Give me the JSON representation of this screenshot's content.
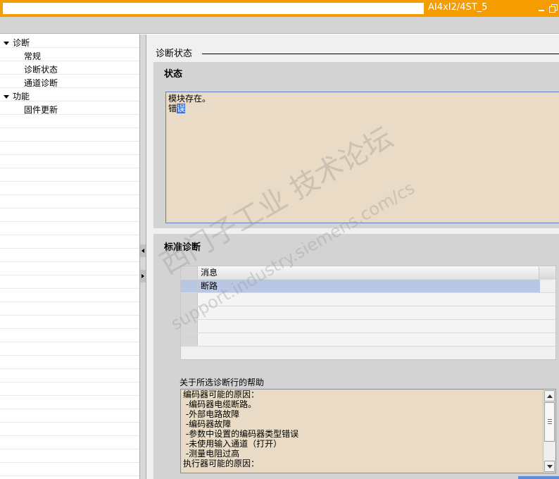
{
  "window": {
    "title": "AI4xI2/4ST_5",
    "buttons": {
      "minimize_icon": "minimize-icon",
      "restore_icon": "restore-icon"
    }
  },
  "nav": {
    "items": [
      {
        "label": "诊断",
        "expanded": true
      },
      {
        "label": "常规"
      },
      {
        "label": "诊断状态",
        "selected": true
      },
      {
        "label": "通道诊断"
      },
      {
        "label": "功能",
        "expanded": true
      },
      {
        "label": "固件更新"
      }
    ]
  },
  "content": {
    "section_header": "诊断状态",
    "status_panel": {
      "title": "状态",
      "line1": "模块存在。",
      "line2_prefix": "错",
      "line2_selected": "误"
    },
    "std_panel": {
      "title": "标准诊断",
      "table": {
        "header": "消息",
        "rows": [
          "断路",
          "",
          "",
          "",
          ""
        ]
      },
      "help_label": "关于所选诊断行的帮助",
      "help_text": "编码器可能的原因：\n -编码器电缆断路。\n -外部电路故障\n -编码器故障\n -参数中设置的编码器类型错误\n -未使用输入通道（打开）\n -测量电阻过高\n执行器可能的原因："
    }
  },
  "watermark": {
    "line1": "西门子工业  技术论坛",
    "line2": "support.industry.siemens.com/cs"
  },
  "colors": {
    "title_bar": "#f59c00",
    "text_area_bg": "#e9dbc5",
    "selection": "#3d72d6",
    "row_selected": "#b9c7e4"
  }
}
